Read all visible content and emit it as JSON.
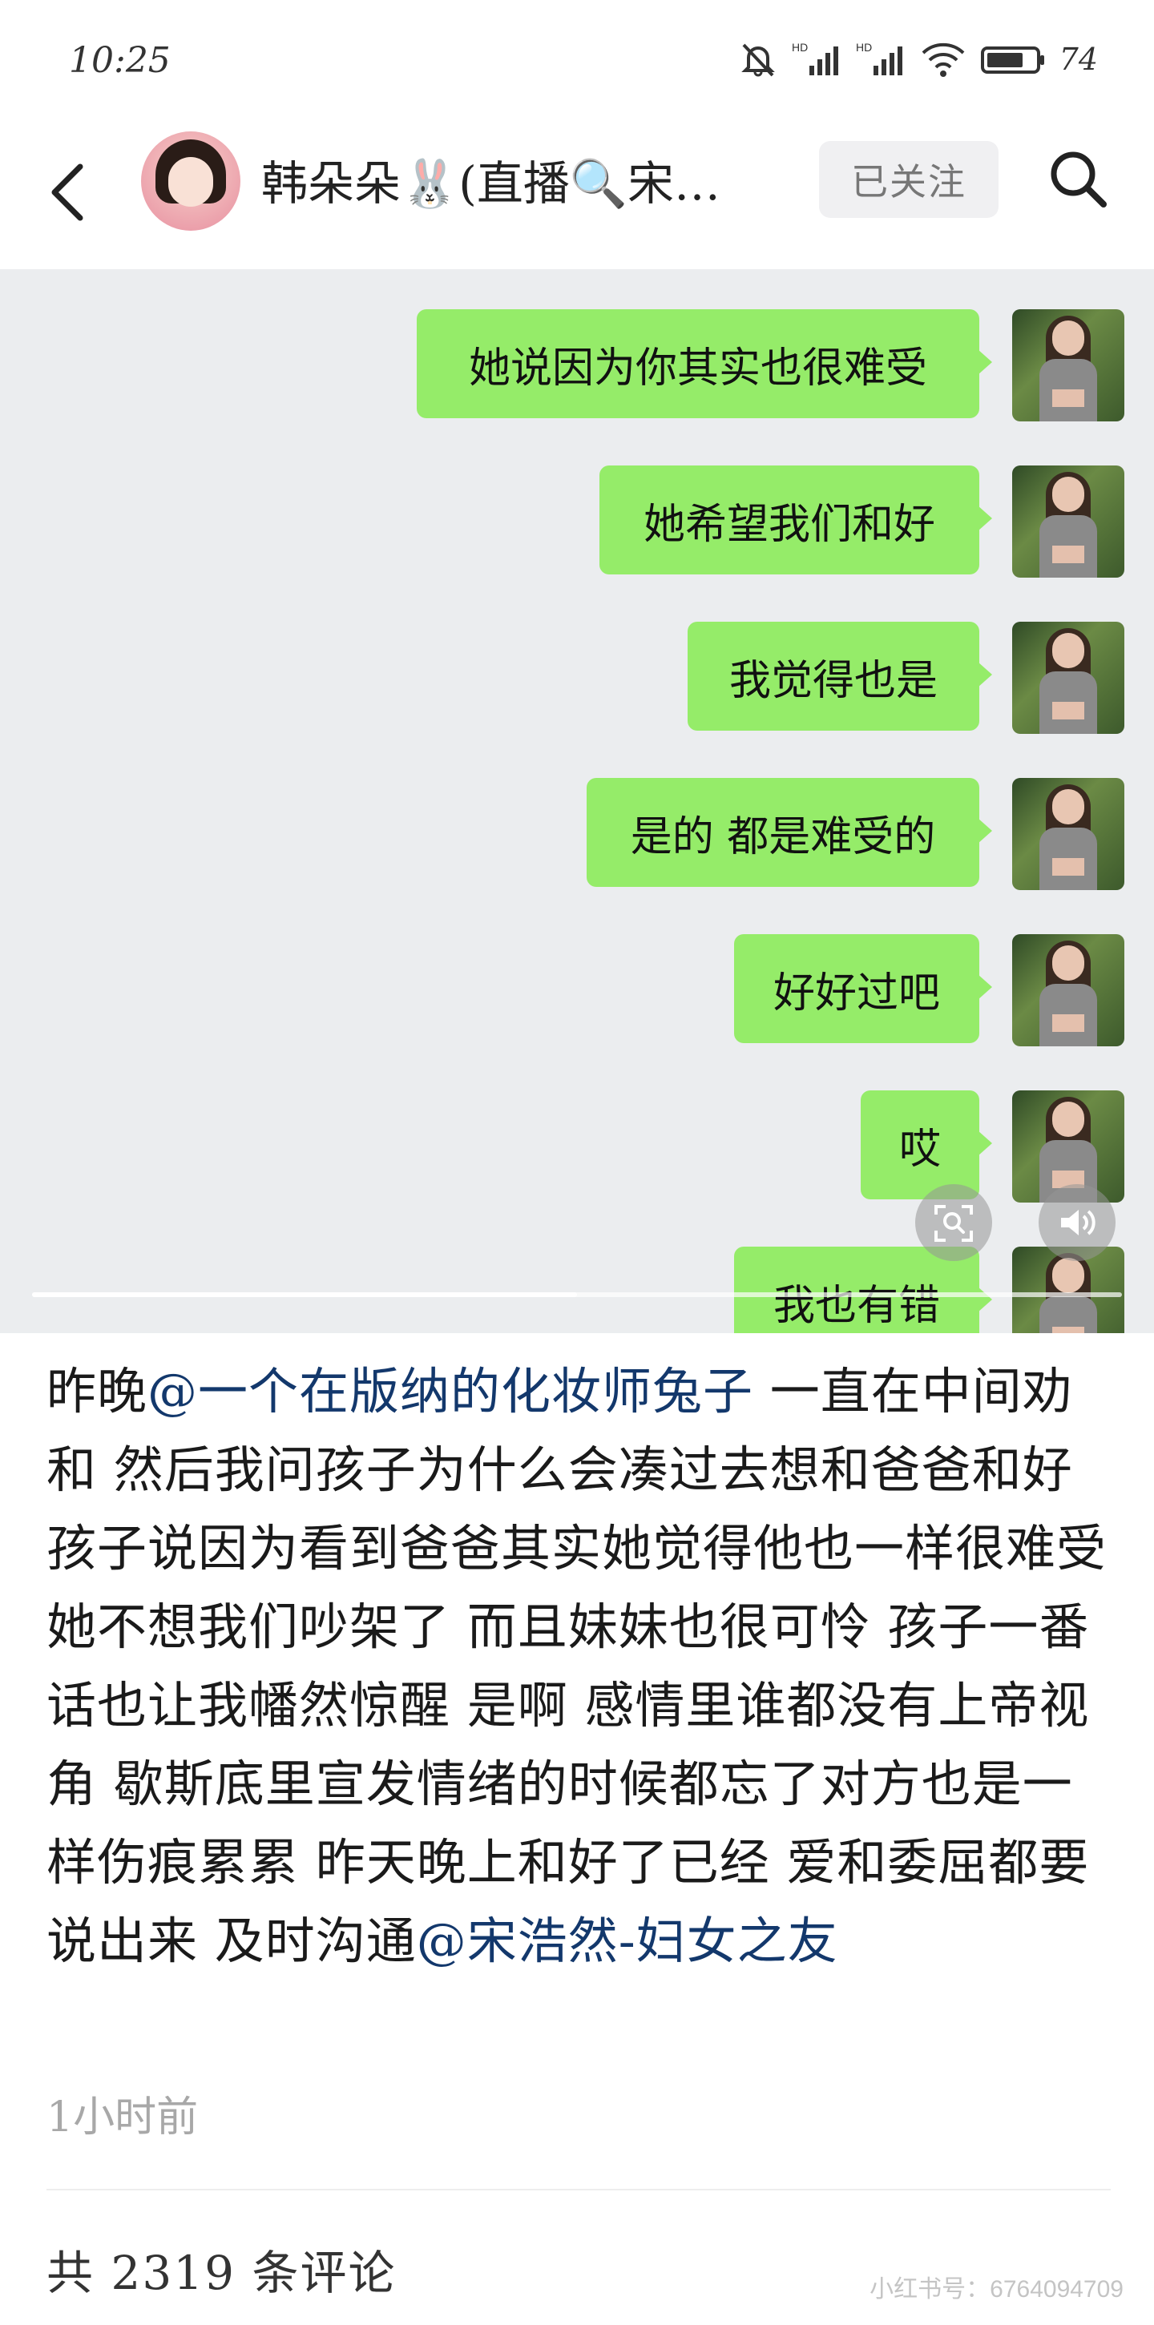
{
  "status_bar": {
    "time": "10:25",
    "battery": "74"
  },
  "header": {
    "title": "韩朵朵🐰(直播🔍宋…",
    "follow_label": "已关注"
  },
  "chat_messages": [
    "她说因为你其实也很难受",
    "她希望我们和好",
    "我觉得也是",
    "是的 都是难受的",
    "好好过吧",
    "哎",
    "我也有错"
  ],
  "media": {
    "progress_fraction": 0.5
  },
  "post": {
    "p1": "昨晚",
    "mention1": "@一个在版纳的化妆师兔子",
    "p2": " 一直在中间劝和 然后我问孩子为什么会凑过去想和爸爸和好 孩子说因为看到爸爸其实她觉得他也一样很难受 她不想我们吵架了 而且妹妹也很可怜 孩子一番话也让我幡然惊醒 是啊 感情里谁都没有上帝视角 歇斯底里宣发情绪的时候都忘了对方也是一样伤痕累累 昨天晚上和好了已经 爱和委屈都要说出来 及时沟通",
    "mention2": "@宋浩然-妇女之友",
    "time_ago": "1小时前"
  },
  "comments": {
    "label": "共 2319 条评论"
  },
  "watermark": "小红书号：6764094709",
  "icons": {
    "mute": "bell-off-icon",
    "signal": "signal-icon",
    "wifi": "wifi-icon",
    "battery": "battery-icon",
    "back": "back-arrow-icon",
    "search": "search-icon",
    "scan": "image-search-icon",
    "volume": "volume-icon"
  },
  "colors": {
    "bubble": "#95ec69",
    "mention": "#13386c",
    "media_bg": "#ebedef"
  }
}
